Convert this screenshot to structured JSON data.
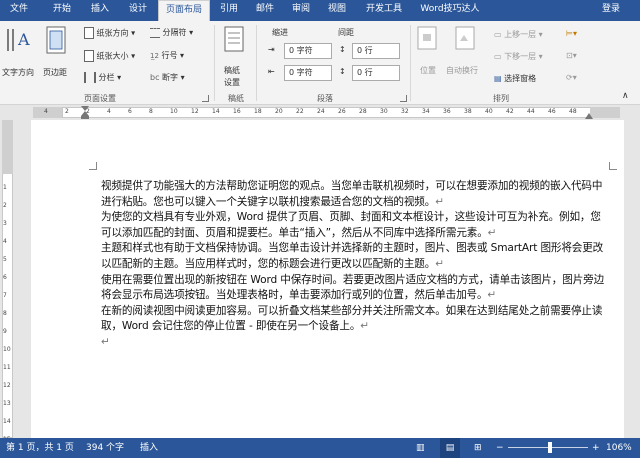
{
  "tabs": [
    "文件",
    "开始",
    "插入",
    "设计",
    "页面布局",
    "引用",
    "邮件",
    "审阅",
    "视图",
    "开发工具",
    "Word技巧达人"
  ],
  "signin": "登录",
  "ribbon": {
    "page_setup": {
      "text_direction": "文字方向",
      "margins": "页边距",
      "orientation": "纸张方向",
      "size": "纸张大小",
      "columns": "分栏",
      "breaks": "分隔符",
      "line_numbers": "行号",
      "hyphenation": "断字",
      "group_label": "页面设置"
    },
    "draft": {
      "paper": "稿纸",
      "settings": "设置",
      "group_label": "稿纸"
    },
    "paragraph": {
      "indent_label": "缩进",
      "spacing_label": "间距",
      "indent_left": "0 字符",
      "indent_right": "0 字符",
      "spacing_before": "0 行",
      "spacing_after": "0 行",
      "group_label": "段落"
    },
    "arrange": {
      "position": "位置",
      "wrap_text": "自动换行",
      "bring_forward": "上移一层",
      "send_backward": "下移一层",
      "selection_pane": "选择窗格",
      "group_label": "排列"
    }
  },
  "ruler": {
    "h_ticks": [
      "4",
      "2",
      "2",
      "4",
      "6",
      "8",
      "10",
      "12",
      "14",
      "16",
      "18",
      "20",
      "22",
      "24",
      "26",
      "28",
      "30",
      "32",
      "34",
      "36",
      "38",
      "40",
      "42",
      "44",
      "46",
      "48"
    ],
    "v_ticks": [
      "1",
      "2",
      "3",
      "4",
      "5",
      "6",
      "7",
      "8",
      "9",
      "10",
      "11",
      "12",
      "13",
      "14",
      "15"
    ]
  },
  "document": {
    "paragraphs": [
      "视频提供了功能强大的方法帮助您证明您的观点。当您单击联机视频时，可以在想要添加的视频的嵌入代码中进行粘贴。您也可以键入一个关键字以联机搜索最适合您的文档的视频。",
      "为使您的文档具有专业外观，Word 提供了页眉、页脚、封面和文本框设计，这些设计可互为补充。例如，您可以添加匹配的封面、页眉和提要栏。单击“插入”，然后从不同库中选择所需元素。",
      "主题和样式也有助于文档保持协调。当您单击设计并选择新的主题时，图片、图表或 SmartArt 图形将会更改以匹配新的主题。当应用样式时，您的标题会进行更改以匹配新的主题。",
      "使用在需要位置出现的新按钮在 Word 中保存时间。若要更改图片适应文档的方式，请单击该图片，图片旁边将会显示布局选项按钮。当处理表格时，单击要添加行或列的位置，然后单击加号。",
      "在新的阅读视图中阅读更加容易。可以折叠文档某些部分并关注所需文本。如果在达到结尾处之前需要停止读取，Word 会记住您的停止位置 - 即使在另一个设备上。",
      ""
    ]
  },
  "status": {
    "page": "第 1 页，共 1 页",
    "words": "394 个字",
    "mode": "插入",
    "zoom": "106%",
    "zoom_level": 1.06
  },
  "colors": {
    "accent": "#2b579a",
    "ribbon_bg": "#f3f3f3"
  }
}
